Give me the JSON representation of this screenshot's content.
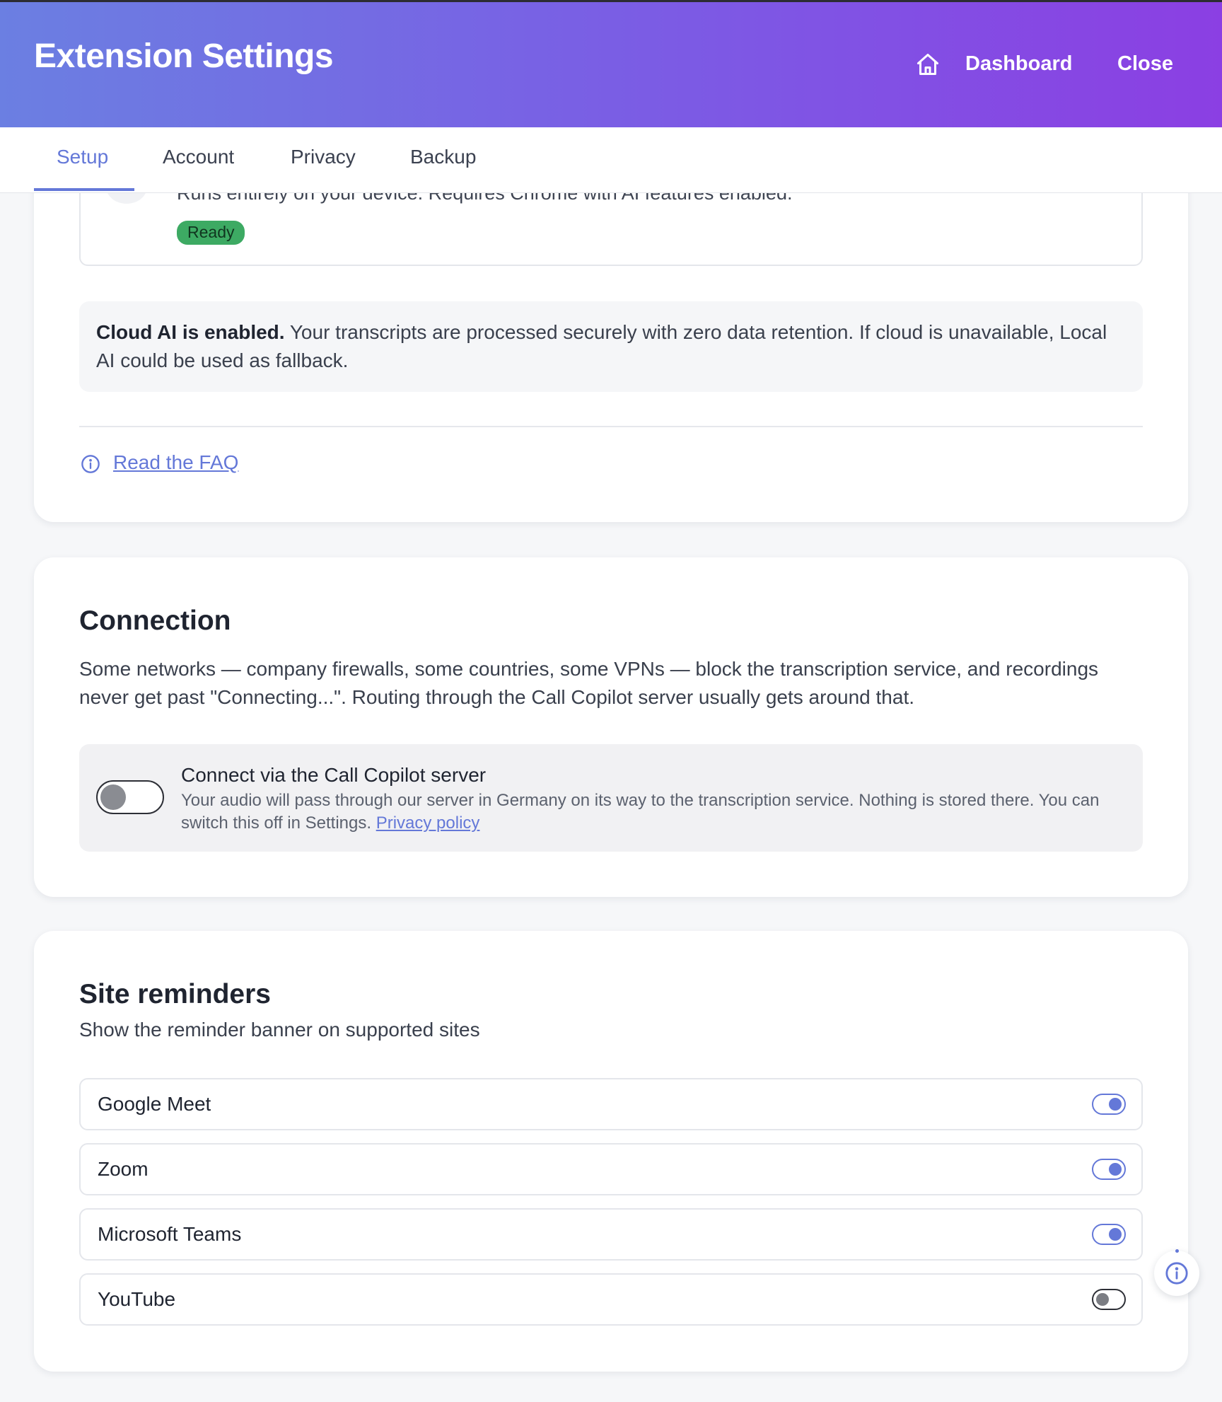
{
  "header": {
    "title": "Extension Settings",
    "dashboard_label": "Dashboard",
    "close_label": "Close"
  },
  "tabs": [
    {
      "label": "Setup",
      "active": true
    },
    {
      "label": "Account",
      "active": false
    },
    {
      "label": "Privacy",
      "active": false
    },
    {
      "label": "Backup",
      "active": false
    }
  ],
  "ai_section": {
    "local_model_description": "Runs entirely on your device. Requires Chrome with AI features enabled.",
    "local_model_status": "Ready",
    "cloud_notice_bold": "Cloud AI is enabled.",
    "cloud_notice_text": " Your transcripts are processed securely with zero data retention. If cloud is unavailable, Local AI could be used as fallback.",
    "faq_link": "Read the FAQ"
  },
  "connection": {
    "title": "Connection",
    "description": "Some networks — company firewalls, some countries, some VPNs — block the transcription service, and recordings never get past \"Connecting...\". Routing through the Call Copilot server usually gets around that.",
    "proxy_title": "Connect via the Call Copilot server",
    "proxy_description": "Your audio will pass through our server in Germany on its way to the transcription service. Nothing is stored there. You can switch this off in Settings. ",
    "privacy_link": "Privacy policy",
    "proxy_enabled": false
  },
  "site_reminders": {
    "title": "Site reminders",
    "subtitle": "Show the reminder banner on supported sites",
    "sites": [
      {
        "label": "Google Meet",
        "enabled": true
      },
      {
        "label": "Zoom",
        "enabled": true
      },
      {
        "label": "Microsoft Teams",
        "enabled": true
      },
      {
        "label": "YouTube",
        "enabled": false
      }
    ]
  },
  "colors": {
    "accent": "#6478d8",
    "header_gradient_start": "#6b7fe2",
    "header_gradient_end": "#8b3fe3",
    "ready_badge": "#3daa63"
  },
  "icons": {
    "dashboard": "home-icon",
    "faq": "info-circle-icon",
    "floating": "info-circle-icon"
  }
}
